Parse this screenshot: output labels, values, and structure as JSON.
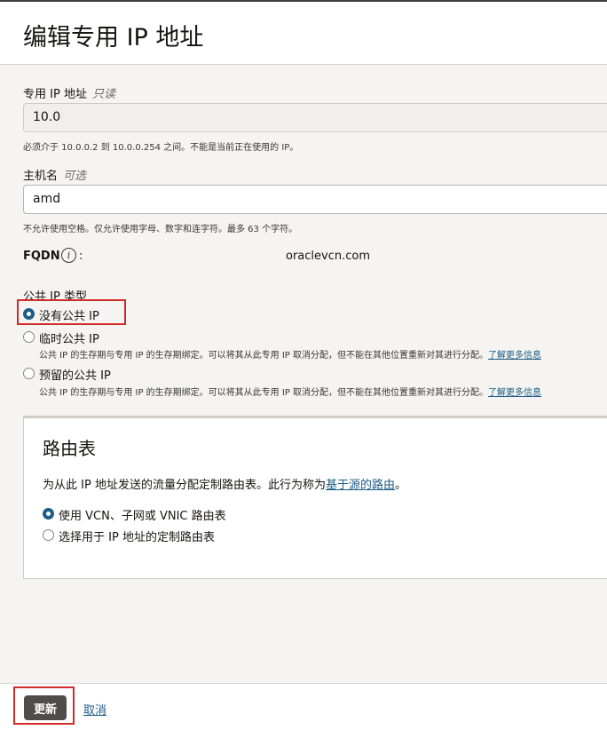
{
  "header": {
    "title": "编辑专用 IP 地址"
  },
  "private_ip": {
    "label": "专用 IP 地址",
    "qualifier": "只读",
    "value": "10.0",
    "hint": "必须介于 10.0.0.2 到 10.0.0.254 之间。不能是当前正在使用的 IP。"
  },
  "hostname": {
    "label": "主机名",
    "qualifier": "可选",
    "value": "amd",
    "hint": "不允许使用空格。仅允许使用字母、数字和连字符。最多 63 个字符。"
  },
  "fqdn": {
    "label": "FQDN",
    "info_glyph": "i",
    "colon": ":",
    "value": "oraclevcn.com"
  },
  "public_ip": {
    "label": "公共 IP 类型",
    "options": [
      {
        "label": "没有公共 IP",
        "selected": true
      },
      {
        "label": "临时公共 IP",
        "selected": false,
        "description": "公共 IP 的生存期与专用 IP 的生存期绑定。可以将其从此专用 IP 取消分配，但不能在其他位置重新对其进行分配。",
        "link": "了解更多信息"
      },
      {
        "label": "预留的公共 IP",
        "selected": false,
        "description": "公共 IP 的生存期与专用 IP 的生存期绑定。可以将其从此专用 IP 取消分配，但不能在其他位置重新对其进行分配。",
        "link": "了解更多信息"
      }
    ]
  },
  "route_table": {
    "title": "路由表",
    "description_prefix": "为从此 IP 地址发送的流量分配定制路由表。此行为称为",
    "description_link": "基于源的路由",
    "description_suffix": "。",
    "options": [
      {
        "label": "使用 VCN、子网或 VNIC 路由表",
        "selected": true
      },
      {
        "label": "选择用于 IP 地址的定制路由表",
        "selected": false
      }
    ]
  },
  "footer": {
    "update_label": "更新",
    "cancel_label": "取消"
  },
  "colors": {
    "accent": "#1d5d86",
    "primary_button": "#4f4d4a",
    "highlight": "#d22a2a"
  }
}
